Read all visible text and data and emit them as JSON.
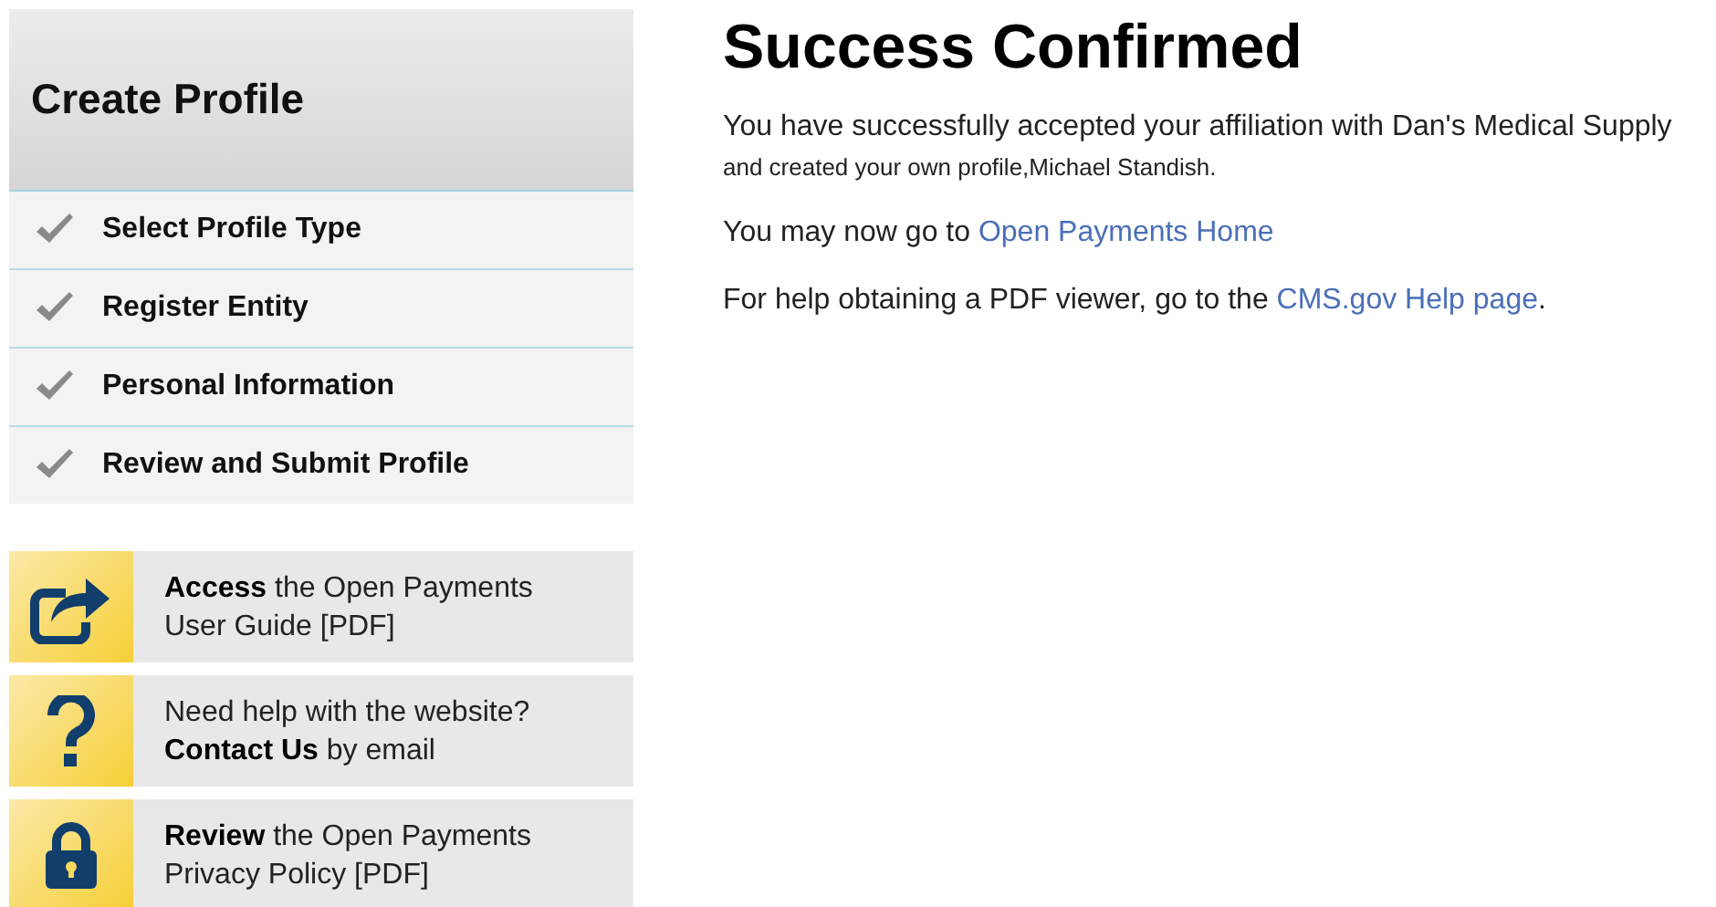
{
  "sidebar": {
    "title": "Create Profile",
    "steps": [
      {
        "label": "Select Profile Type",
        "completed": true
      },
      {
        "label": "Register Entity",
        "completed": true
      },
      {
        "label": "Personal Information",
        "completed": true
      },
      {
        "label": "Review and Submit Profile",
        "completed": true
      }
    ],
    "help_links": [
      {
        "kind": "share",
        "text": "**Access** the Open Payments User Guide [PDF]"
      },
      {
        "kind": "question",
        "text": "Need help with the website? **Contact Us** by email"
      },
      {
        "kind": "lock",
        "text": "**Review** the Open Payments Privacy Policy [PDF]"
      }
    ]
  },
  "main": {
    "title": "Success Confirmed",
    "message_line_1": "You have successfully accepted your affiliation with Dan's Medical Supply",
    "message_line_2": "and created your own profile,Michael Standish.",
    "home_prefix": "You may now go to",
    "home_link": "Open Payments Home",
    "help_prefix": "For help obtaining a PDF viewer, go to the",
    "help_link": "CMS.gov Help page",
    "help_suffix": "."
  }
}
